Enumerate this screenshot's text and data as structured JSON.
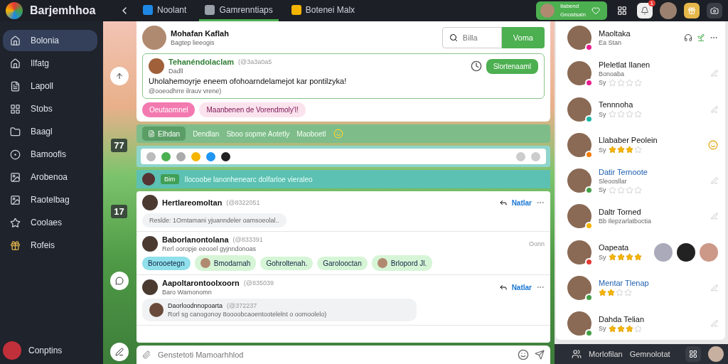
{
  "app": {
    "title": "Barjemhhoa"
  },
  "tabs": [
    {
      "label": "Noolant",
      "selected": false
    },
    {
      "label": "Gamrenntiaps",
      "selected": true
    },
    {
      "label": "Botenei Malx",
      "selected": false
    }
  ],
  "status_pill": {
    "line_1": "Ilabend",
    "line_2": "Gnostsaln"
  },
  "notifications": {
    "badge": "1"
  },
  "sidebar": {
    "items": [
      {
        "label": "Bolonia",
        "selected": true
      },
      {
        "label": "Ilfatg",
        "selected": false
      },
      {
        "label": "Lapoll",
        "selected": false
      },
      {
        "label": "Stobs",
        "selected": false
      },
      {
        "label": "Baagl",
        "selected": false
      },
      {
        "label": "Bamoofis",
        "selected": false
      },
      {
        "label": "Arobenoa",
        "selected": false
      },
      {
        "label": "Raotelbag",
        "selected": false
      },
      {
        "label": "Coolaes",
        "selected": false
      },
      {
        "label": "Rofeis",
        "selected": false
      }
    ],
    "user": "Conptins"
  },
  "scene_badges": [
    "77",
    "17"
  ],
  "profile": {
    "name": "Mohafan Kaflah",
    "subtitle": "Bagtep lieeogis",
    "search": {
      "value": "Billa"
    },
    "button": "Voma"
  },
  "composer": {
    "name": "Tehanéndolaclam",
    "meta": "(@3a3a0a5",
    "sub": "Dadll",
    "button": "Slortenaaml",
    "text": "Uholahemoyrje eneem ofohoarndelamejot kar pontilzyka!",
    "mention": "@ooeodhrre ilrauv vrene)"
  },
  "tags": [
    {
      "label": "Oeutaomnel",
      "selected": true
    },
    {
      "label": "Maanbenen de Vorendmoly'l!",
      "selected": false
    }
  ],
  "filter_bar": {
    "button": "Elhdan",
    "items": [
      "Dendlan",
      "Sboo sopme Aotetly",
      "Maoboetl"
    ]
  },
  "banner": {
    "tag": "Bim",
    "text": "Ilocoobe lanonhenearc dolfarloe vieraleo"
  },
  "posts": [
    {
      "name": "Hertlareomoltan",
      "meta": "(@8322051",
      "action": "Natlar",
      "body": "Reslde: 1Orntamani yjuanndeler oamsoeolal.."
    },
    {
      "name": "Baborlanontolana",
      "meta": "(@833391",
      "time": "Oonn",
      "sub": "Rerl ooropje eeooel gyjnndonoas",
      "chips": [
        {
          "label": "Borooetegn",
          "selected": true,
          "with_avatar": false
        },
        {
          "label": "Bmodarnah",
          "selected": false,
          "with_avatar": true
        },
        {
          "label": "Gohroltenah.",
          "selected": false,
          "with_avatar": false
        },
        {
          "label": "Garolooctan",
          "selected": false,
          "with_avatar": false
        },
        {
          "label": "Brlopord Jl.",
          "selected": false,
          "with_avatar": true
        }
      ]
    },
    {
      "name": "Aapoltarontoolxoorn",
      "meta": "(@835039",
      "action": "Natlar",
      "sub": "Baro Wamonomn",
      "reply": {
        "name": "Daorloodnnopoarta",
        "meta": "(@372237",
        "text": "Rorl sg canogonoy 8oooobcaoentootelelnt o oomoolelo)"
      }
    }
  ],
  "message_input": {
    "placeholder": "Genstetoti Mamoarhhlod"
  },
  "contacts": [
    {
      "name": "Maoltaka",
      "sub": "Ea Stan",
      "color": "#e91e8c",
      "highlighted": false,
      "kind": "actions"
    },
    {
      "name": "Pleletlat Ilanen",
      "sub": "Bonoaba",
      "rating": {
        "label": "Sy",
        "stars": 0
      },
      "color": "#e91e8c",
      "highlighted": false,
      "kind": "edit"
    },
    {
      "name": "Tennnoha",
      "rating": {
        "label": "Sy",
        "stars": 0
      },
      "color": "#1fb5a5",
      "highlighted": false,
      "kind": "edit"
    },
    {
      "name": "Llababer Peolein",
      "rating": {
        "label": "Sy",
        "stars": 3
      },
      "color": "#f57c00",
      "highlighted": false,
      "kind": "emoji"
    },
    {
      "name": "Datir Ternoote",
      "sub": "Sleoosllar",
      "rating": {
        "label": "Sy",
        "stars": 0
      },
      "color": "#43a047",
      "highlighted": true,
      "kind": "edit"
    },
    {
      "name": "Daltr Torned",
      "sub": "Bb Ilepzarlatboctia",
      "color": "#f5b400",
      "highlighted": false,
      "kind": "edit"
    },
    {
      "name": "Oapeata",
      "rating": {
        "label": "Sy",
        "stars": 4
      },
      "color": "#e53935",
      "highlighted": false,
      "kind": "avatars"
    },
    {
      "name": "Mentar Tlenap",
      "rating": {
        "stars": 2
      },
      "color": "#43a047",
      "highlighted": true,
      "kind": "edit"
    },
    {
      "name": "Dahda Telian",
      "rating": {
        "label": "Sy",
        "stars": 3
      },
      "color": "#43a047",
      "highlighted": false,
      "kind": "edit"
    }
  ],
  "bottom_bar": {
    "user": "Morlofilan",
    "label": "Gemnolotat"
  }
}
